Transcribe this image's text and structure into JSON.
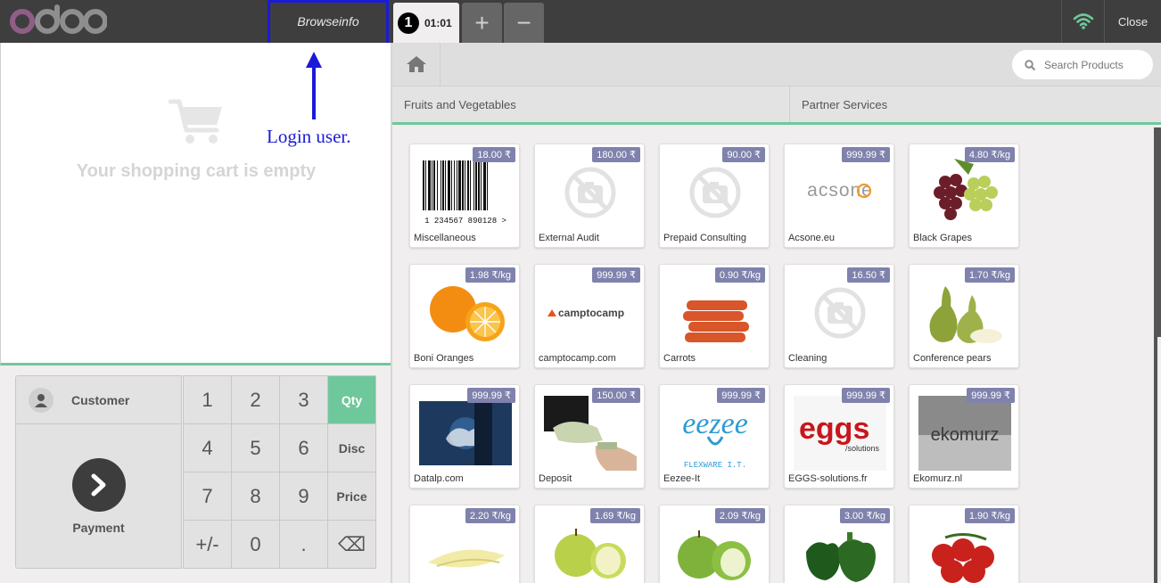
{
  "header": {
    "logo_text": "odoo",
    "user_name": "Browseinfo",
    "order_number": "1",
    "order_time": "01:01",
    "add_order_symbol": "+",
    "remove_order_symbol": "−",
    "close_label": "Close",
    "wifi_icon": "wifi-icon",
    "wifi_color": "#6ec89b"
  },
  "annotation": {
    "text": "Login user.",
    "color": "#1a1ad8"
  },
  "cart": {
    "empty_text": "Your shopping cart is empty"
  },
  "actionpad": {
    "customer_label": "Customer",
    "payment_label": "Payment"
  },
  "numpad": {
    "keys": [
      "1",
      "2",
      "3",
      "Qty",
      "4",
      "5",
      "6",
      "Disc",
      "7",
      "8",
      "9",
      "Price",
      "+/-",
      "0",
      ".",
      "⌫"
    ],
    "selected_mode": "Qty"
  },
  "search": {
    "placeholder": "Search Products"
  },
  "categories": [
    "Fruits and Vegetables",
    "Partner Services"
  ],
  "products": [
    {
      "name": "Miscellaneous",
      "price": "18.00 ₹",
      "image": "barcode",
      "barcode_text": "1 234567 890128 >"
    },
    {
      "name": "External Audit",
      "price": "180.00 ₹",
      "image": "no-photo"
    },
    {
      "name": "Prepaid Consulting",
      "price": "90.00 ₹",
      "image": "no-photo"
    },
    {
      "name": "Acsone.eu",
      "price": "999.99 ₹",
      "image": "acsone-logo",
      "logo_text": "acsone"
    },
    {
      "name": "Black Grapes",
      "price": "4.80 ₹/kg",
      "image": "grapes"
    },
    {
      "name": "Boni Oranges",
      "price": "1.98 ₹/kg",
      "image": "oranges"
    },
    {
      "name": "camptocamp.com",
      "price": "999.99 ₹",
      "image": "camptocamp-logo",
      "logo_text": "camptocamp"
    },
    {
      "name": "Carrots",
      "price": "0.90 ₹/kg",
      "image": "carrots"
    },
    {
      "name": "Cleaning",
      "price": "16.50 ₹",
      "image": "no-photo"
    },
    {
      "name": "Conference pears",
      "price": "1.70 ₹/kg",
      "image": "pears"
    },
    {
      "name": "Datalp.com",
      "price": "999.99 ₹",
      "image": "datalp-photo"
    },
    {
      "name": "Deposit",
      "price": "150.00 ₹",
      "image": "money-photo"
    },
    {
      "name": "Eezee-It",
      "price": "999.99 ₹",
      "image": "eezee-logo",
      "logo_text": "eezee",
      "logo_sub": "FLEXWARE I.T."
    },
    {
      "name": "EGGS-solutions.fr",
      "price": "999.99 ₹",
      "image": "eggs-logo",
      "logo_text": "eggs",
      "logo_sub": "/solutions"
    },
    {
      "name": "Ekomurz.nl",
      "price": "999.99 ₹",
      "image": "ekomurz-logo",
      "logo_text": "ekomurz"
    },
    {
      "name": "",
      "price": "2.20 ₹/kg",
      "image": "endive"
    },
    {
      "name": "",
      "price": "1.69 ₹/kg",
      "image": "golden-apples"
    },
    {
      "name": "",
      "price": "2.09 ₹/kg",
      "image": "green-apples"
    },
    {
      "name": "",
      "price": "3.00 ₹/kg",
      "image": "green-peppers"
    },
    {
      "name": "",
      "price": "1.90 ₹/kg",
      "image": "tomatoes"
    }
  ]
}
